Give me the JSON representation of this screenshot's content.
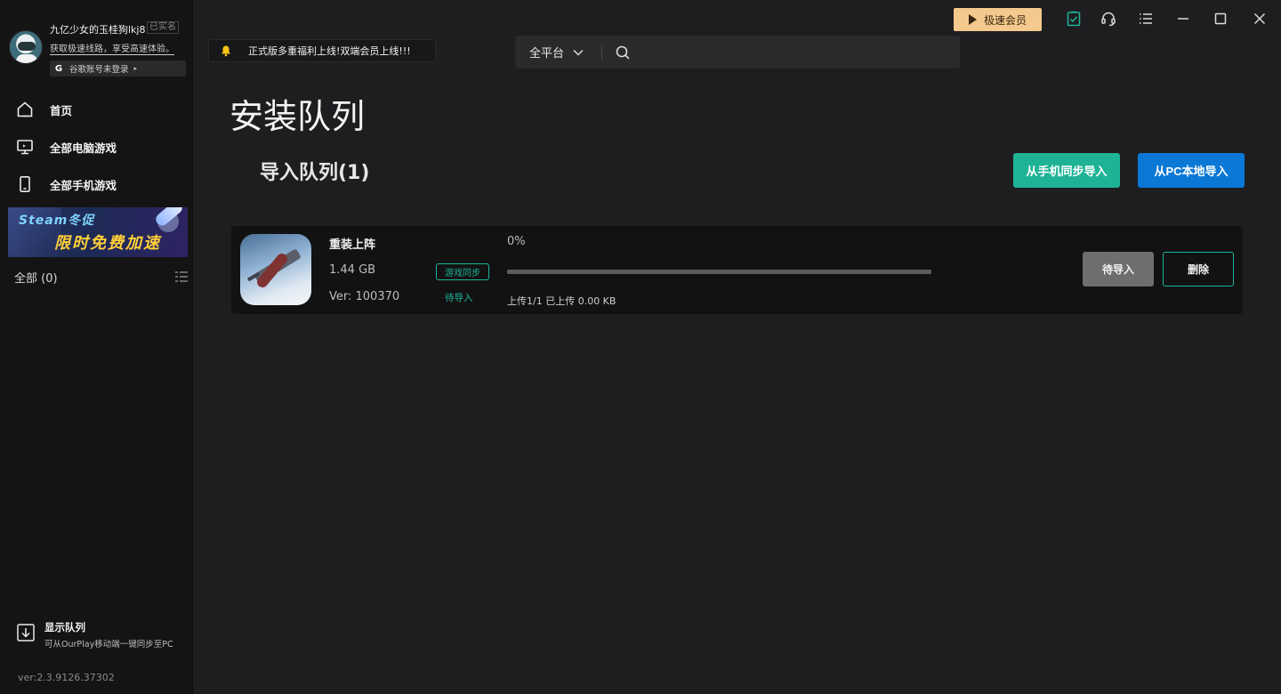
{
  "user": {
    "name": "九亿少女的玉桂狗lkj8",
    "verified_label": "已实名",
    "tip": "获取极速线路，享受高速体验。",
    "google_status": "谷歌账号未登录"
  },
  "sidebar": {
    "items": [
      {
        "label": "首页",
        "icon": "home-icon"
      },
      {
        "label": "全部电脑游戏",
        "icon": "monitor-icon"
      },
      {
        "label": "全部手机游戏",
        "icon": "phone-icon"
      }
    ],
    "banner": {
      "line1": "Steam冬促",
      "line2": "限时免费加速"
    },
    "all_label": "全部 (0)",
    "queue": {
      "title": "显示队列",
      "subtitle": "可从OurPlay移动端一键同步至PC"
    },
    "version": "ver:2.3.9126.37302"
  },
  "notice": {
    "text": "正式版多重福利上线!双端会员上线!!!"
  },
  "search": {
    "platform": "全平台",
    "placeholder": "",
    "value": ""
  },
  "vip": {
    "label": "极速会员"
  },
  "main": {
    "title": "安装队列",
    "section_title": "导入队列(1)",
    "btn_phone": "从手机同步导入",
    "btn_pc": "从PC本地导入"
  },
  "queue_items": [
    {
      "name": "重装上阵",
      "size": "1.44 GB",
      "version": "Ver: 100370",
      "badge": "游戏同步",
      "state": "待导入",
      "percent_label": "0%",
      "progress": 0,
      "upload_status": "上传1/1 已上传 0.00 KB",
      "btn_wait": "待导入",
      "btn_delete": "删除"
    }
  ],
  "colors": {
    "accent": "#1fb396",
    "primary": "#0b78d6",
    "vip": "#f4c98d",
    "background": "#1e1e21",
    "sidebar": "#141415"
  }
}
